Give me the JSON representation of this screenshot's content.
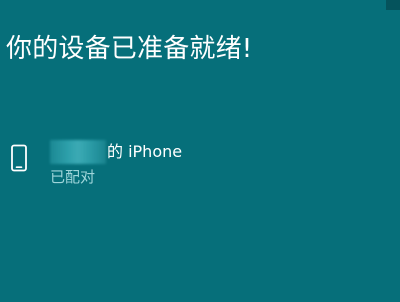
{
  "title": "你的设备已准备就绪!",
  "device": {
    "name_suffix": "的 iPhone",
    "status": "已配对",
    "icon": "phone-icon"
  },
  "colors": {
    "background": "#066f7a",
    "text": "#ffffff",
    "secondary_text": "#9fd5da",
    "corner": "#05535c"
  }
}
